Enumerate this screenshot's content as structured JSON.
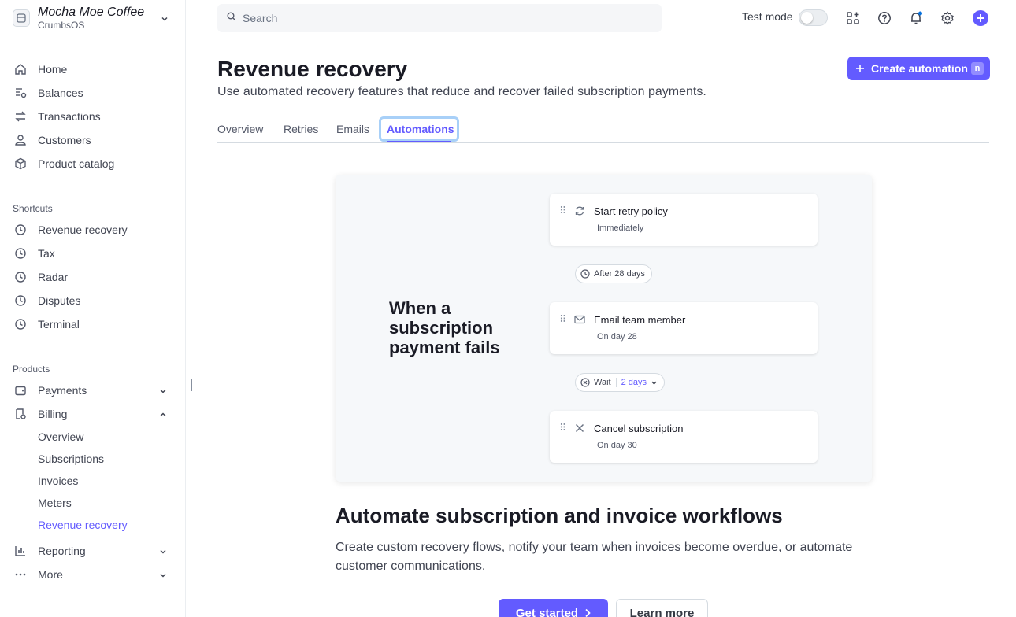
{
  "account": {
    "name": "Mocha Moe Coffee",
    "platform": "CrumbsOS"
  },
  "nav": {
    "main": [
      "Home",
      "Balances",
      "Transactions",
      "Customers",
      "Product catalog"
    ],
    "shortcuts_label": "Shortcuts",
    "shortcuts": [
      "Revenue recovery",
      "Tax",
      "Radar",
      "Disputes",
      "Terminal"
    ],
    "products_label": "Products",
    "payments": "Payments",
    "billing": "Billing",
    "billing_sub": [
      "Overview",
      "Subscriptions",
      "Invoices",
      "Meters",
      "Revenue recovery"
    ],
    "reporting": "Reporting",
    "more": "More"
  },
  "topbar": {
    "search_placeholder": "Search",
    "test_mode": "Test mode"
  },
  "page": {
    "title": "Revenue recovery",
    "subtitle": "Use automated recovery features that reduce and recover failed subscription payments.",
    "create_button": "Create automation",
    "create_shortcut": "n"
  },
  "tabs": [
    "Overview",
    "Retries",
    "Emails",
    "Automations"
  ],
  "active_tab": "Automations",
  "illustration": {
    "heading": "When a subscription payment fails",
    "steps": [
      {
        "title": "Start retry policy",
        "sub": "Immediately",
        "icon": "refresh-icon"
      },
      {
        "title": "Email team member",
        "sub": "On day 28",
        "icon": "mail-icon"
      },
      {
        "title": "Cancel subscription",
        "sub": "On day 30",
        "icon": "close-icon"
      }
    ],
    "delay1": "After 28 days",
    "wait_label": "Wait",
    "wait_value": "2 days"
  },
  "promo": {
    "title": "Automate subscription and invoice workflows",
    "body": "Create custom recovery flows, notify your team when invoices become overdue, or automate customer communications.",
    "primary": "Get started",
    "secondary": "Learn more"
  },
  "colors": {
    "accent": "#635bff",
    "text": "#414552",
    "heading": "#1a1b25"
  }
}
